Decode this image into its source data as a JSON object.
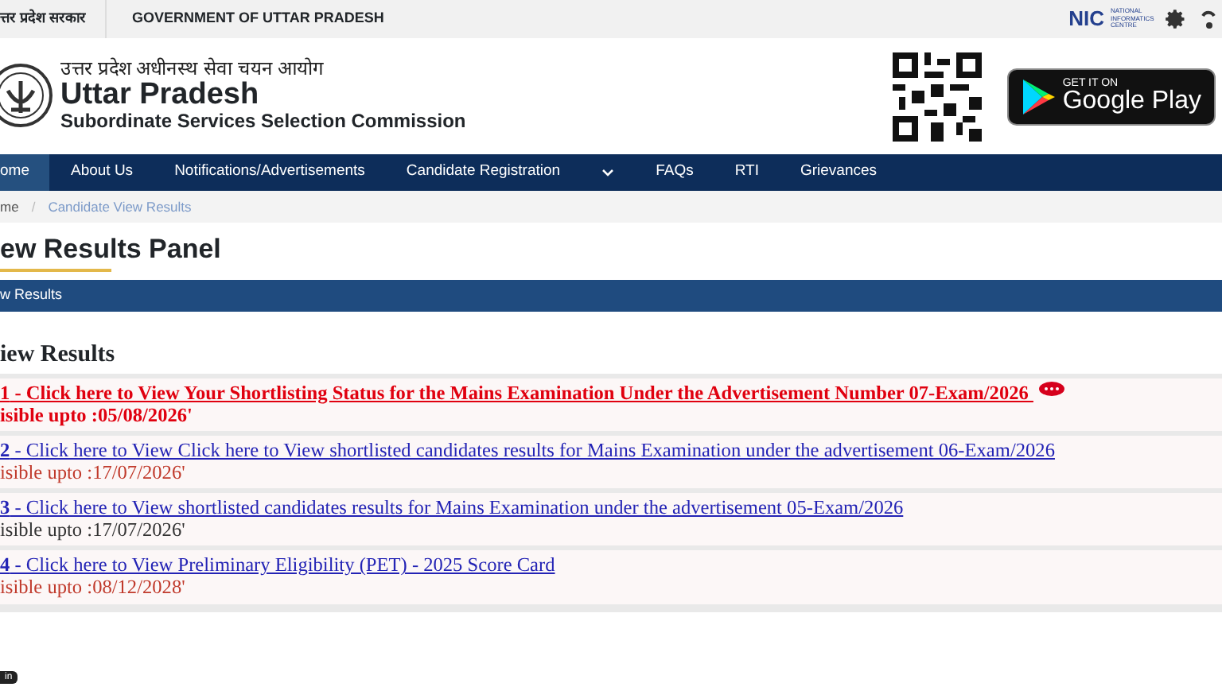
{
  "top_bar": {
    "hindi_label": "त्तर प्रदेश सरकार",
    "english_label": "GOVERNMENT OF UTTAR PRADESH",
    "nic_label": "NIC",
    "nic_sub": "NATIONAL INFORMATICS CENTRE"
  },
  "header": {
    "hindi_title": "उत्तर प्रदेश अधीनस्थ सेवा चयन आयोग",
    "title": "Uttar Pradesh",
    "subtitle": "Subordinate Services Selection Commission",
    "store_small": "GET IT ON",
    "store_big": "Google Play"
  },
  "nav": [
    {
      "label": "ome",
      "selected": true,
      "kind": "link"
    },
    {
      "label": "About Us",
      "selected": false,
      "kind": "link"
    },
    {
      "label": "Notifications/Advertisements",
      "selected": false,
      "kind": "link"
    },
    {
      "label": "Candidate Registration",
      "selected": false,
      "kind": "link"
    },
    {
      "selected": false,
      "kind": "caret"
    },
    {
      "label": "FAQs",
      "selected": false,
      "kind": "link"
    },
    {
      "label": "RTI",
      "selected": false,
      "kind": "link"
    },
    {
      "label": "Grievances",
      "selected": false,
      "kind": "link"
    }
  ],
  "breadcrumb": [
    "me",
    "Candidate View Results"
  ],
  "breadcrumb_separator": "/",
  "page_title": "ew Results Panel",
  "panel_bar": "w Results",
  "section_heading": "iew Results",
  "results": [
    {
      "number": "1",
      "link": " - Click here to View Your Shortlisting Status for the Mains Examination Under the Advertisement Number 07-Exam/2026 ",
      "visible": "isible upto :05/08/2026'",
      "highlighted": true,
      "new_badge": true,
      "color": "#e0000f"
    },
    {
      "number": "2",
      "link": " - Click here to View Click here to View shortlisted candidates results for Mains Examination under the advertisement 06-Exam/2026",
      "visible": "isible upto :17/07/2026'",
      "highlighted": false,
      "new_badge": false,
      "color": "#c0392b"
    },
    {
      "number": "3",
      "link": " - Click here to View shortlisted candidates results for Mains Examination under the advertisement 05-Exam/2026",
      "visible": "isible upto :17/07/2026'",
      "highlighted": false,
      "new_badge": false,
      "color": "#333333"
    },
    {
      "number": "4",
      "link": " - Click here to View Preliminary Eligibility (PET) - 2025 Score Card",
      "visible": "isible upto :08/12/2028'",
      "highlighted": false,
      "new_badge": false,
      "color": "#c0392b"
    }
  ],
  "corner_badge": "in"
}
